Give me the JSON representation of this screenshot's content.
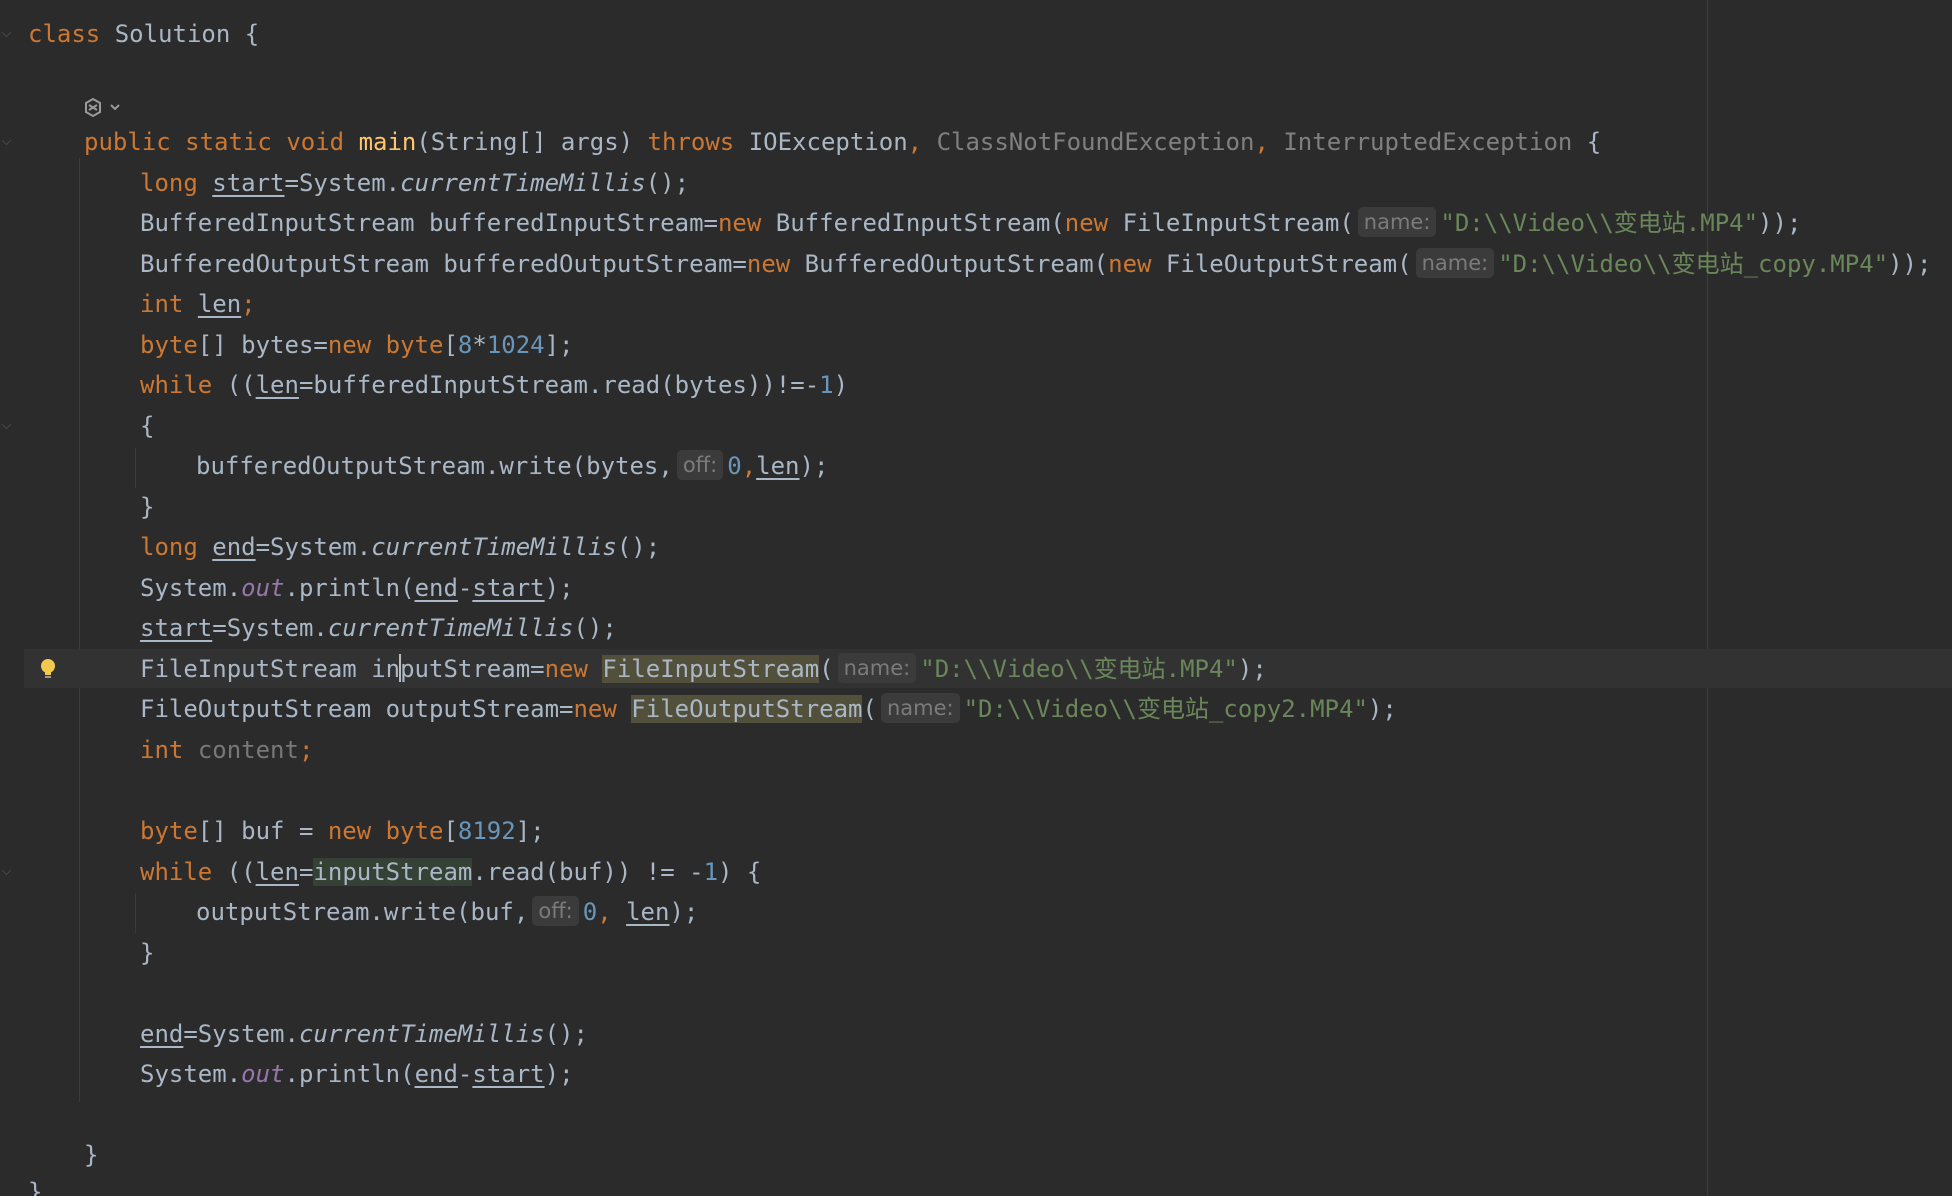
{
  "editor": {
    "language": "java",
    "string_color": "#6a8759",
    "keyword_color": "#cc7832",
    "background_color": "#2b2b2b"
  },
  "code": {
    "class_kw": "class",
    "class_name": "Solution",
    "class_open": " {",
    "main_public": "public",
    "main_static": "static",
    "main_void": "void",
    "main_name": "main",
    "main_params": "(String[] args) ",
    "main_throws": "throws",
    "exc1": "IOException",
    "exc2": "ClassNotFoundException",
    "exc3": "InterruptedException",
    "comma": ",",
    "main_open": " {",
    "l3_type": "long",
    "l3_var": "start",
    "l3_eq": "=System.",
    "l3_call": "currentTimeMillis",
    "l3_end": "();",
    "l4_a": "BufferedInputStream bufferedInputStream=",
    "l4_new1": "new",
    "l4_b": " BufferedInputStream(",
    "l4_new2": "new",
    "l4_c": " FileInputStream(",
    "l4_hint": "name:",
    "l4_str": "\"D:\\\\Video\\\\变电站.MP4\"",
    "l4_end": "));",
    "l5_a": "BufferedOutputStream bufferedOutputStream=",
    "l5_new1": "new",
    "l5_b": " BufferedOutputStream(",
    "l5_new2": "new",
    "l5_c": " FileOutputStream(",
    "l5_hint": "name:",
    "l5_str": "\"D:\\\\Video\\\\变电站_copy.MP4\"",
    "l5_end": "));",
    "l6_type": "int",
    "l6_var": "len",
    "l6_end": ";",
    "l7_type": "byte",
    "l7_a": "[] bytes=",
    "l7_new": "new",
    "l7_type2": "byte",
    "l7_b": "[",
    "l7_n1": "8",
    "l7_op": "*",
    "l7_n2": "1024",
    "l7_end": "];",
    "l8_kw": "while",
    "l8_a": " ((",
    "l8_var": "len",
    "l8_b": "=bufferedInputStream.read(bytes))!=-",
    "l8_num": "1",
    "l8_end": ")",
    "l9": "{",
    "l10_a": "bufferedOutputStream.write(bytes,",
    "l10_hint": "off:",
    "l10_num": "0",
    "l10_b": ",",
    "l10_var": "len",
    "l10_end": ");",
    "l11": "}",
    "l12_type": "long",
    "l12_var": "end",
    "l12_eq": "=System.",
    "l12_call": "currentTimeMillis",
    "l12_end": "();",
    "l13_a": "System.",
    "l13_field": "out",
    "l13_b": ".println(",
    "l13_v1": "end",
    "l13_op": "-",
    "l13_v2": "start",
    "l13_end": ");",
    "l14_var": "start",
    "l14_eq": "=System.",
    "l14_call": "currentTimeMillis",
    "l14_end": "();",
    "l15_a": "FileInputStream ",
    "l15_var_a": "in",
    "l15_var_b": "putStream",
    "l15_b": "=",
    "l15_new": "new",
    "l15_cls": "FileInputStream",
    "l15_c": "(",
    "l15_hint": "name:",
    "l15_str": "\"D:\\\\Video\\\\变电站.MP4\"",
    "l15_end": ");",
    "l16_a": "FileOutputStream outputStream=",
    "l16_new": "new",
    "l16_cls": "FileOutputStream",
    "l16_c": "(",
    "l16_hint": "name:",
    "l16_str": "\"D:\\\\Video\\\\变电站_copy2.MP4\"",
    "l16_end": ");",
    "l17_type": "int",
    "l17_var": "content",
    "l17_end": ";",
    "l19_type": "byte",
    "l19_a": "[] buf = ",
    "l19_new": "new",
    "l19_type2": "byte",
    "l19_b": "[",
    "l19_num": "8192",
    "l19_end": "];",
    "l20_kw": "while",
    "l20_a": " ((",
    "l20_var": "len",
    "l20_b": "=",
    "l20_ident": "inputStream",
    "l20_c": ".read(buf)) != -",
    "l20_num": "1",
    "l20_end": ") {",
    "l21_a": "outputStream.write(buf,",
    "l21_hint": "off:",
    "l21_num": "0",
    "l21_b": ",",
    "l21_var": "len",
    "l21_end": ");",
    "l22": "}",
    "l24_var": "end",
    "l24_eq": "=System.",
    "l24_call": "currentTimeMillis",
    "l24_end": "();",
    "l25_a": "System.",
    "l25_field": "out",
    "l25_b": ".println(",
    "l25_v1": "end",
    "l25_op": "-",
    "l25_v2": "start",
    "l25_end": ");",
    "l27": "}",
    "l28": "}"
  },
  "icons": {
    "gutter_bulb": "lightbulb-icon",
    "ai_assistant": "ai-assistant-icon"
  }
}
